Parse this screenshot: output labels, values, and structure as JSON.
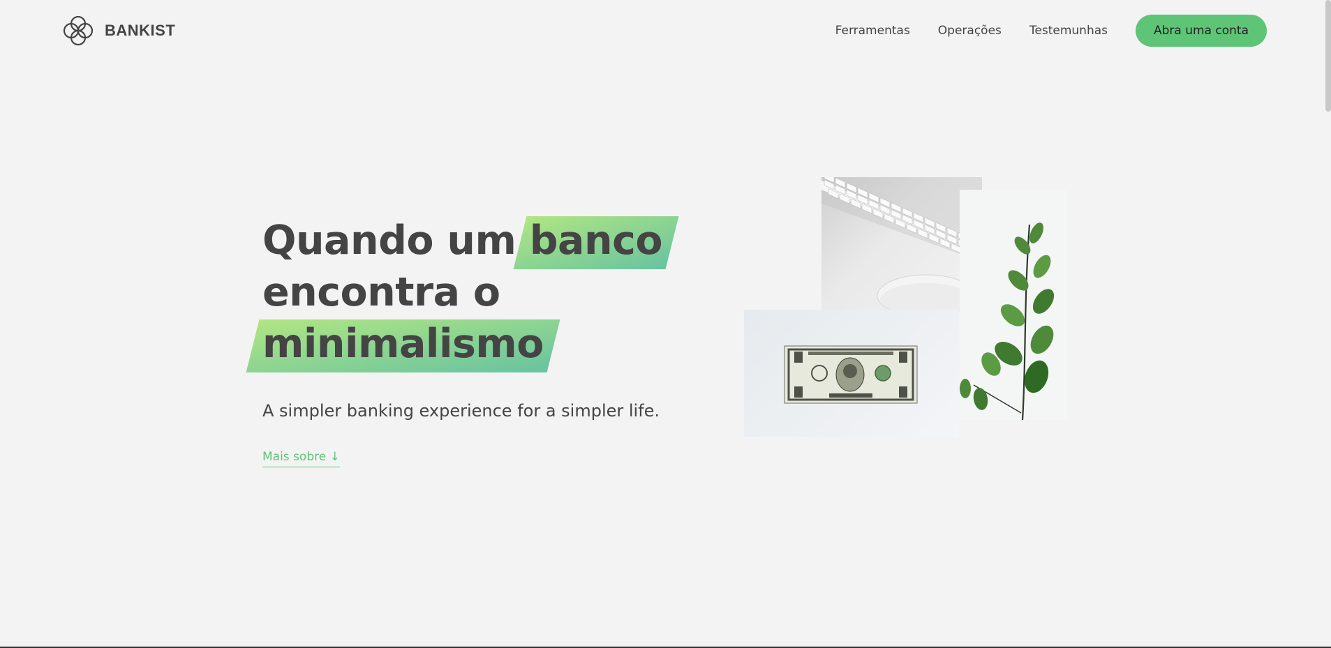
{
  "brand": {
    "name": "BANKIST",
    "logo_icon": "four-circles-logo-icon"
  },
  "nav": {
    "links": [
      "Ferramentas",
      "Operações",
      "Testemunhas"
    ],
    "cta_label": "Abra uma conta"
  },
  "hero": {
    "title_part1": "Quando um",
    "title_highlight1": "banco",
    "title_line2": "encontra o",
    "title_highlight2": "minimalismo",
    "subtitle": "A simpler banking experience for a simpler life.",
    "learn_more": "Mais sobre ↓"
  },
  "colors": {
    "accent": "#5ec576",
    "background": "#f3f3f3",
    "text": "#444444",
    "gradient_from": "#9be15d",
    "gradient_to": "#39b385"
  },
  "images": {
    "keyboard": "keyboard-mouse-photo",
    "plant": "plant-photo",
    "dollar": "dollar-bill-photo"
  }
}
